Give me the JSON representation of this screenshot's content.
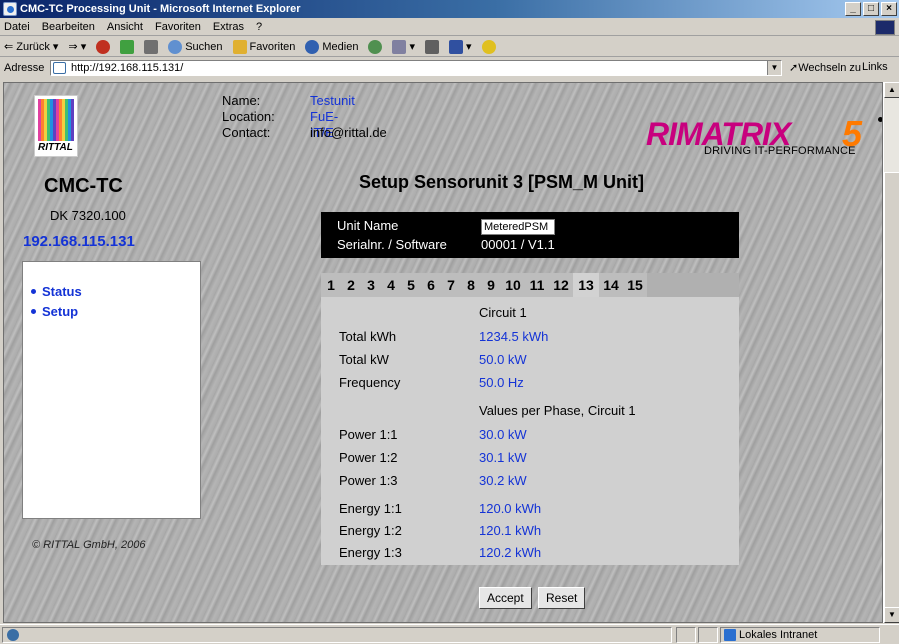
{
  "window": {
    "title": "CMC-TC Processing Unit - Microsoft Internet Explorer",
    "min": "_",
    "max": "□",
    "close": "×"
  },
  "menu": [
    "Datei",
    "Bearbeiten",
    "Ansicht",
    "Favoriten",
    "Extras",
    "?"
  ],
  "toolbar": {
    "back": "⇐ Zurück",
    "search": "Suchen",
    "favorites": "Favoriten",
    "media": "Medien"
  },
  "address": {
    "label": "Adresse",
    "url": "http://192.168.115.131/",
    "go": "Wechseln zu",
    "links": "Links"
  },
  "device": {
    "name_label": "Name:",
    "location_label": "Location:",
    "contact_label": "Contact:",
    "name": "Testunit",
    "location": "FuE-IT/E",
    "contact": "info@rittal.de"
  },
  "logo_text": "RITTAL",
  "brand": {
    "name": "RIMATRIX",
    "number": "5",
    "slogan": "DRIVING IT-PERFORMANCE"
  },
  "sidebar": {
    "title": "CMC-TC",
    "model": "DK 7320.100",
    "ip": "192.168.115.131",
    "items": [
      {
        "label": "Status"
      },
      {
        "label": "Setup"
      }
    ],
    "copyright": "© RITTAL GmbH, 2006"
  },
  "main": {
    "title": "Setup Sensorunit 3 [PSM_M Unit]",
    "unit_name_label": "Unit Name",
    "unit_name_value": "MeteredPSM",
    "serial_label": "Serialnr. / Software",
    "serial_value": "00001 / V1.1",
    "tabs": [
      "1",
      "2",
      "3",
      "4",
      "5",
      "6",
      "7",
      "8",
      "9",
      "10",
      "11",
      "12",
      "13",
      "14",
      "15"
    ],
    "active_tab": "13",
    "circuit_heading": "Circuit 1",
    "rows": [
      {
        "label": "Total kWh",
        "value": "1234.5 kWh"
      },
      {
        "label": "Total kW",
        "value": "50.0 kW"
      },
      {
        "label": "Frequency",
        "value": "50.0 Hz"
      }
    ],
    "phase_heading": "Values per Phase, Circuit 1",
    "power_rows": [
      {
        "label": "Power 1:1",
        "value": "30.0 kW"
      },
      {
        "label": "Power 1:2",
        "value": "30.1 kW"
      },
      {
        "label": "Power 1:3",
        "value": "30.2 kW"
      }
    ],
    "energy_rows": [
      {
        "label": "Energy 1:1",
        "value": "120.0 kWh"
      },
      {
        "label": "Energy 1:2",
        "value": "120.1 kWh"
      },
      {
        "label": "Energy 1:3",
        "value": "120.2 kWh"
      }
    ],
    "accept_label": "Accept",
    "reset_label": "Reset"
  },
  "status": {
    "zone": "Lokales Intranet"
  }
}
